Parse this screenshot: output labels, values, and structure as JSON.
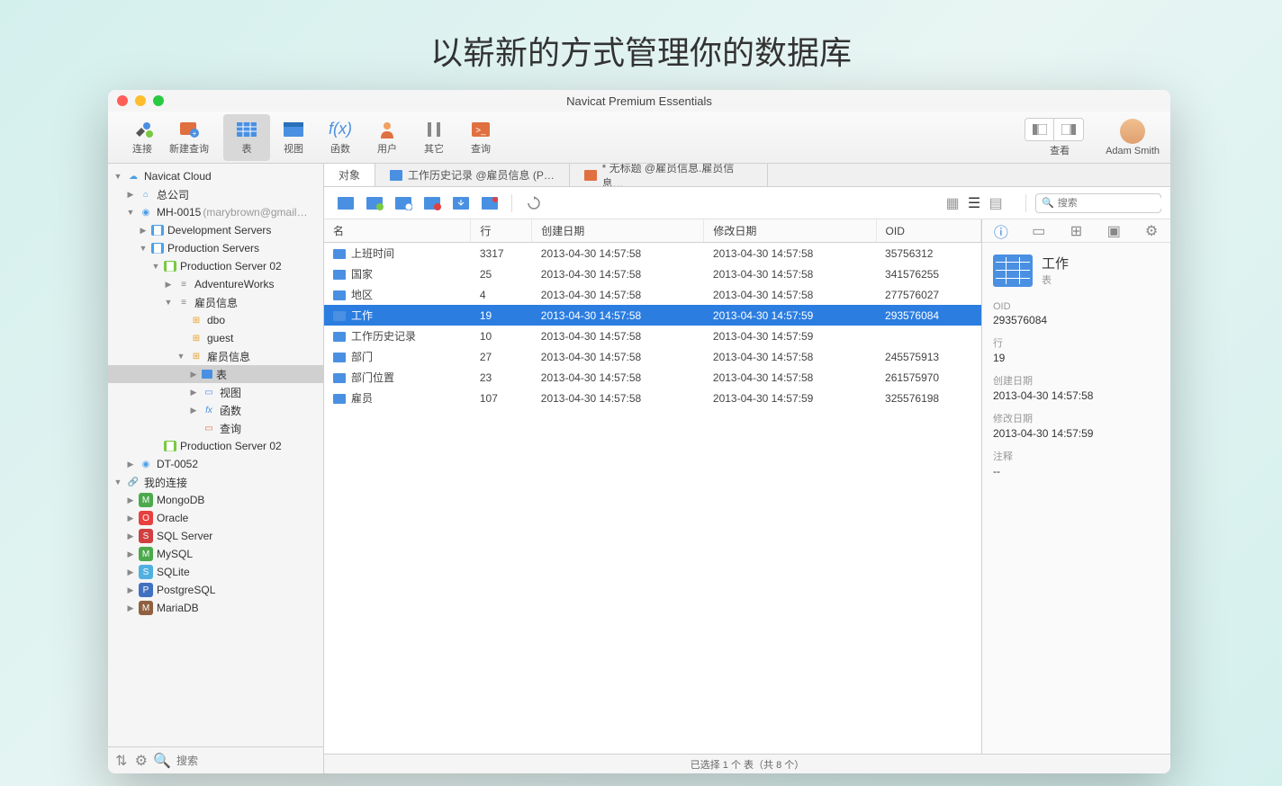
{
  "hero": "以崭新的方式管理你的数据库",
  "window_title": "Navicat Premium Essentials",
  "toolbar": {
    "connection": "连接",
    "new_query": "新建查询",
    "table": "表",
    "view": "视图",
    "function": "函数",
    "user": "用户",
    "other": "其它",
    "query": "查询",
    "view_label": "查看",
    "user_name": "Adam Smith"
  },
  "sidebar": {
    "search_placeholder": "搜索",
    "items": [
      {
        "depth": 0,
        "arrow": "down",
        "icon": "cloud",
        "label": "Navicat Cloud"
      },
      {
        "depth": 1,
        "arrow": "right",
        "icon": "home",
        "label": "总公司"
      },
      {
        "depth": 1,
        "arrow": "down",
        "icon": "user",
        "label": "MH-0015",
        "suffix": "(marybrown@gmail…"
      },
      {
        "depth": 2,
        "arrow": "right",
        "icon": "folder",
        "label": "Development Servers"
      },
      {
        "depth": 2,
        "arrow": "down",
        "icon": "folder",
        "label": "Production Servers"
      },
      {
        "depth": 3,
        "arrow": "down",
        "icon": "server",
        "label": "Production Server 02"
      },
      {
        "depth": 4,
        "arrow": "right",
        "icon": "db",
        "label": "AdventureWorks"
      },
      {
        "depth": 4,
        "arrow": "down",
        "icon": "db",
        "label": "雇员信息"
      },
      {
        "depth": 5,
        "arrow": "",
        "icon": "schema",
        "label": "dbo"
      },
      {
        "depth": 5,
        "arrow": "",
        "icon": "schema",
        "label": "guest"
      },
      {
        "depth": 5,
        "arrow": "down",
        "icon": "schema",
        "label": "雇员信息"
      },
      {
        "depth": 6,
        "arrow": "right",
        "icon": "table",
        "label": "表",
        "selected": true
      },
      {
        "depth": 6,
        "arrow": "right",
        "icon": "view",
        "label": "视图"
      },
      {
        "depth": 6,
        "arrow": "right",
        "icon": "fx",
        "label": "函数"
      },
      {
        "depth": 6,
        "arrow": "",
        "icon": "query",
        "label": "查询"
      },
      {
        "depth": 3,
        "arrow": "",
        "icon": "server",
        "label": "Production Server 02"
      },
      {
        "depth": 1,
        "arrow": "right",
        "icon": "user",
        "label": "DT-0052"
      },
      {
        "depth": 0,
        "arrow": "down",
        "icon": "link",
        "label": "我的连接"
      },
      {
        "depth": 1,
        "arrow": "right",
        "icon": "mongo",
        "label": "MongoDB"
      },
      {
        "depth": 1,
        "arrow": "right",
        "icon": "oracle",
        "label": "Oracle"
      },
      {
        "depth": 1,
        "arrow": "right",
        "icon": "mssql",
        "label": "SQL Server"
      },
      {
        "depth": 1,
        "arrow": "right",
        "icon": "mysql",
        "label": "MySQL"
      },
      {
        "depth": 1,
        "arrow": "right",
        "icon": "sqlite",
        "label": "SQLite"
      },
      {
        "depth": 1,
        "arrow": "right",
        "icon": "pg",
        "label": "PostgreSQL"
      },
      {
        "depth": 1,
        "arrow": "right",
        "icon": "maria",
        "label": "MariaDB"
      }
    ]
  },
  "tabs": [
    {
      "label": "对象",
      "active": true
    },
    {
      "label": "工作历史记录 @雇员信息 (P…",
      "icon": "table"
    },
    {
      "label": "* 无标题 @雇员信息.雇员信息…",
      "icon": "query"
    }
  ],
  "search_placeholder": "搜索",
  "table": {
    "columns": [
      "名",
      "行",
      "创建日期",
      "修改日期",
      "OID"
    ],
    "rows": [
      {
        "name": "上班时间",
        "rows": "3317",
        "created": "2013-04-30 14:57:58",
        "modified": "2013-04-30 14:57:58",
        "oid": "35756312"
      },
      {
        "name": "国家",
        "rows": "25",
        "created": "2013-04-30 14:57:58",
        "modified": "2013-04-30 14:57:58",
        "oid": "341576255"
      },
      {
        "name": "地区",
        "rows": "4",
        "created": "2013-04-30 14:57:58",
        "modified": "2013-04-30 14:57:58",
        "oid": "277576027"
      },
      {
        "name": "工作",
        "rows": "19",
        "created": "2013-04-30 14:57:58",
        "modified": "2013-04-30 14:57:59",
        "oid": "293576084",
        "selected": true
      },
      {
        "name": "工作历史记录",
        "rows": "10",
        "created": "2013-04-30 14:57:58",
        "modified": "2013-04-30 14:57:59",
        "oid": ""
      },
      {
        "name": "部门",
        "rows": "27",
        "created": "2013-04-30 14:57:58",
        "modified": "2013-04-30 14:57:58",
        "oid": "245575913"
      },
      {
        "name": "部门位置",
        "rows": "23",
        "created": "2013-04-30 14:57:58",
        "modified": "2013-04-30 14:57:58",
        "oid": "261575970"
      },
      {
        "name": "雇员",
        "rows": "107",
        "created": "2013-04-30 14:57:58",
        "modified": "2013-04-30 14:57:59",
        "oid": "325576198"
      }
    ]
  },
  "info": {
    "title": "工作",
    "subtitle": "表",
    "fields": [
      {
        "label": "OID",
        "value": "293576084"
      },
      {
        "label": "行",
        "value": "19"
      },
      {
        "label": "创建日期",
        "value": "2013-04-30 14:57:58"
      },
      {
        "label": "修改日期",
        "value": "2013-04-30 14:57:59"
      },
      {
        "label": "注释",
        "value": "--"
      }
    ]
  },
  "status": "已选择 1 个 表（共 8 个）"
}
